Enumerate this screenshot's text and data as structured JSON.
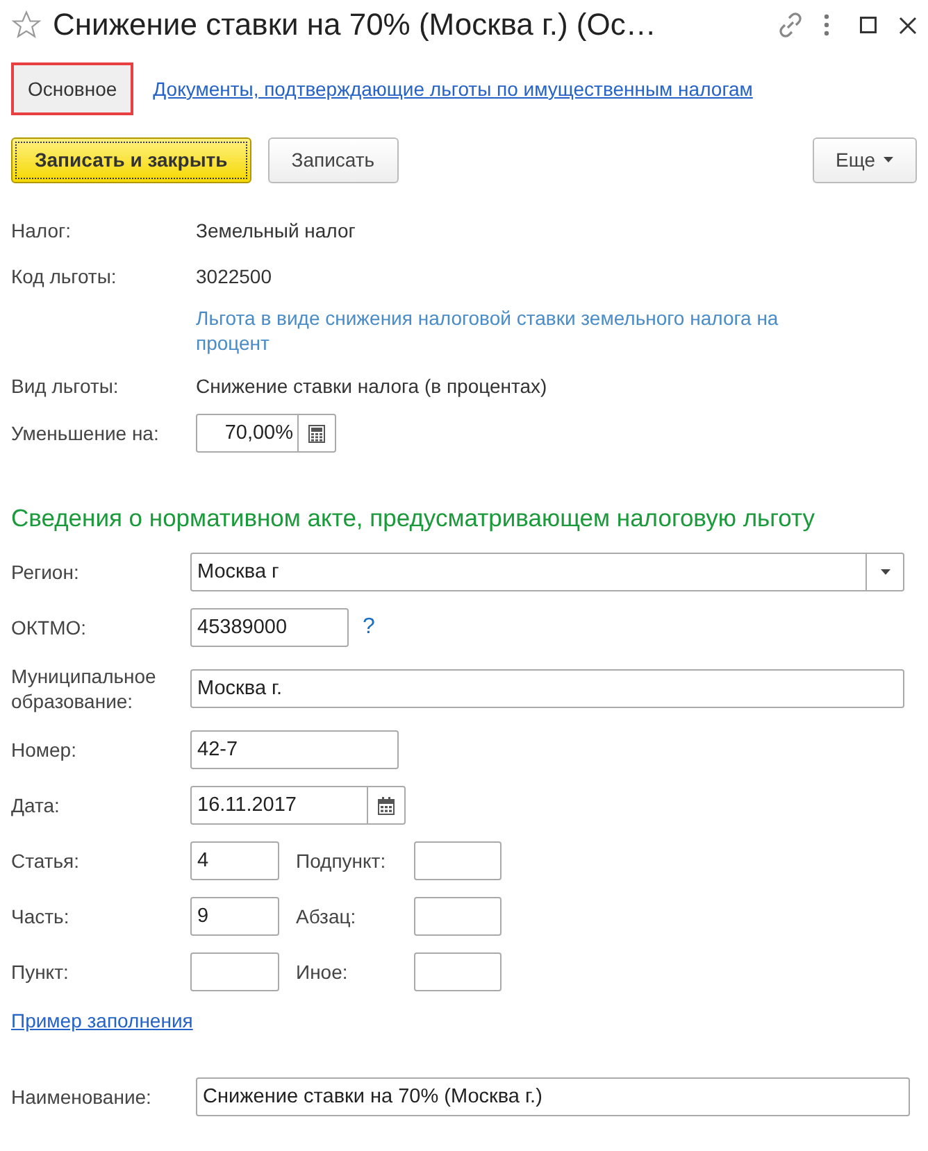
{
  "window": {
    "title": "Снижение ставки на 70% (Москва г.) (Ос…",
    "favorite": false
  },
  "tabs": [
    {
      "label": "Основное",
      "selected": true,
      "kind": "tab"
    },
    {
      "label": "Документы, подтверждающие льготы по имущественным налогам",
      "selected": false,
      "kind": "link"
    }
  ],
  "toolbar": [
    {
      "label": "Записать и закрыть",
      "kind": "primary"
    },
    {
      "label": "Записать",
      "kind": "default"
    },
    {
      "label": "Еще",
      "kind": "menu"
    }
  ],
  "info": [
    {
      "label": "Налог:",
      "value": "Земельный налог"
    },
    {
      "label": "Код льготы:",
      "value": "3022500",
      "note": "Льгота в виде снижения налоговой ставки земельного налога на процент"
    },
    {
      "label": "Вид льготы:",
      "value": "Снижение ставки налога (в процентах)"
    }
  ],
  "reduction": {
    "label": "Уменьшение на:",
    "value": "70,00%"
  },
  "section_title": "Сведения о нормативном акте, предусматривающем налоговую льготу",
  "act_fields": [
    {
      "kind": "select",
      "label": "Регион:",
      "value": "Москва г"
    },
    {
      "kind": "help",
      "label": "ОКТМО:",
      "value": "45389000",
      "help": "?"
    },
    {
      "kind": "wide",
      "label": "Муниципальное образование:",
      "value": "Москва г."
    },
    {
      "kind": "medium",
      "label": "Номер:",
      "value": "42-7"
    },
    {
      "kind": "date",
      "label": "Дата:",
      "value": "16.11.2017"
    },
    {
      "kind": "pair",
      "label": "Статья:",
      "value": "4",
      "right_label": "Подпункт:"
    },
    {
      "kind": "pair",
      "label": "Часть:",
      "value": "9",
      "right_label": "Абзац:"
    },
    {
      "kind": "pair",
      "label": "Пункт:",
      "right_label": "Иное:"
    }
  ],
  "example_link": "Пример заполнения",
  "name_field": {
    "label": "Наименование:",
    "value": "Снижение ставки на 70% (Москва г.)"
  }
}
